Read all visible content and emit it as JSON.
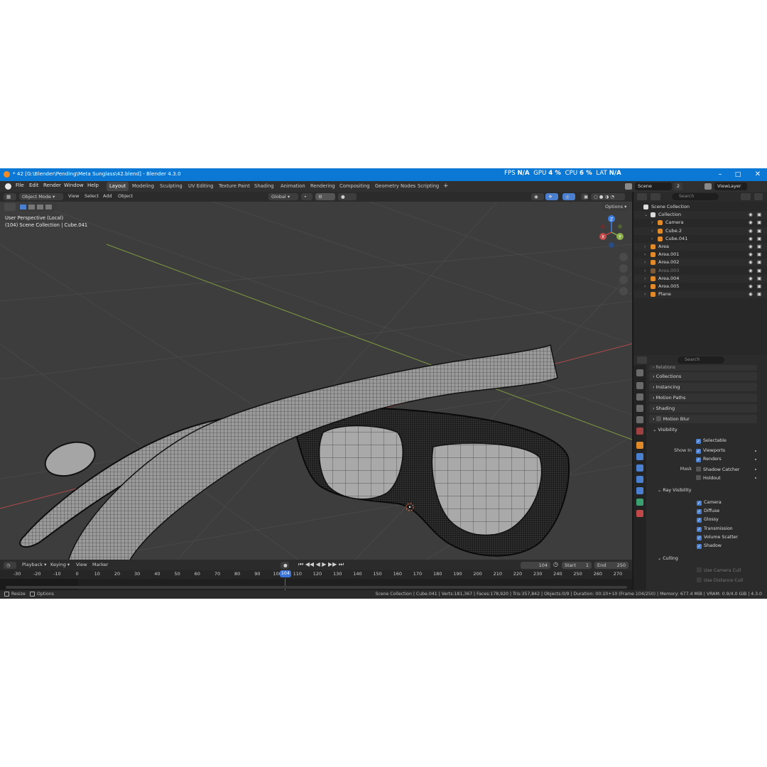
{
  "window": {
    "title": "* 42 [G:\\Blender\\Pending\\Meta Sunglass\\42.blend] - Blender 4.3.0",
    "fps_label": "FPS",
    "fps_value": "N/A",
    "gpu_label": "GPU",
    "gpu_value": "4 %",
    "cpu_label": "CPU",
    "cpu_value": "6 %",
    "lat_label": "LAT",
    "lat_value": "N/A"
  },
  "menubar": {
    "items": [
      "File",
      "Edit",
      "Render",
      "Window",
      "Help"
    ],
    "workspaces": [
      "Layout",
      "Modeling",
      "Sculpting",
      "UV Editing",
      "Texture Paint",
      "Shading",
      "Animation",
      "Rendering",
      "Compositing",
      "Geometry Nodes",
      "Scripting"
    ],
    "add_tab": "+",
    "scene": "Scene",
    "scene_count": "2",
    "view_layer": "ViewLayer"
  },
  "viewport_header": {
    "mode": "Object Mode",
    "view": "View",
    "select": "Select",
    "add": "Add",
    "object": "Object",
    "orientation": "Global",
    "options": "Options"
  },
  "viewport": {
    "perspective": "User Perspective (Local)",
    "collection_info": "(104) Scene Collection | Cube.041",
    "gizmo_x": "X",
    "gizmo_y": "Y",
    "gizmo_z": "Z"
  },
  "outliner": {
    "search_placeholder": "Search",
    "rows": [
      {
        "name": "Scene Collection",
        "indent": 0,
        "type": "scene"
      },
      {
        "name": "Collection",
        "indent": 1,
        "type": "collection"
      },
      {
        "name": "Camera",
        "indent": 2,
        "type": "camera"
      },
      {
        "name": "Cube.2",
        "indent": 2,
        "type": "mesh"
      },
      {
        "name": "Cube.041",
        "indent": 2,
        "type": "mesh"
      },
      {
        "name": "Area",
        "indent": 1,
        "type": "light"
      },
      {
        "name": "Area.001",
        "indent": 1,
        "type": "light"
      },
      {
        "name": "Area.002",
        "indent": 1,
        "type": "light"
      },
      {
        "name": "Area.003",
        "indent": 1,
        "type": "light-dim"
      },
      {
        "name": "Area.004",
        "indent": 1,
        "type": "light"
      },
      {
        "name": "Area.005",
        "indent": 1,
        "type": "light"
      },
      {
        "name": "Plane",
        "indent": 1,
        "type": "mesh"
      }
    ]
  },
  "properties": {
    "search_placeholder": "Search",
    "sections": {
      "relations": "Relations",
      "collections": "Collections",
      "instancing": "Instancing",
      "motion_paths": "Motion Paths",
      "shading": "Shading",
      "motion_blur": "Motion Blur",
      "visibility": "Visibility",
      "ray_visibility": "Ray Visibility",
      "culling": "Culling"
    },
    "visibility": {
      "selectable": "Selectable",
      "show_in_label": "Show In",
      "viewports": "Viewports",
      "renders": "Renders",
      "mask_label": "Mask",
      "shadow_catcher": "Shadow Catcher",
      "holdout": "Holdout"
    },
    "ray_visibility": [
      "Camera",
      "Diffuse",
      "Glossy",
      "Transmission",
      "Volume Scatter",
      "Shadow"
    ],
    "culling": {
      "use_camera_cull": "Use Camera Cull",
      "use_distance_cull": "Use Distance Cull"
    }
  },
  "timeline": {
    "playback": "Playback",
    "keying": "Keying",
    "view": "View",
    "marker": "Marker",
    "current_frame": "104",
    "start_label": "Start",
    "start_value": "1",
    "end_label": "End",
    "end_value": "250",
    "ticks": [
      "-30",
      "-20",
      "-10",
      "0",
      "10",
      "20",
      "30",
      "40",
      "50",
      "60",
      "70",
      "80",
      "90",
      "100",
      "110",
      "120",
      "130",
      "140",
      "150",
      "160",
      "170",
      "180",
      "190",
      "200",
      "210",
      "220",
      "230",
      "240",
      "250",
      "260",
      "270"
    ],
    "playhead_label": "104"
  },
  "statusbar": {
    "resize": "Resize",
    "options": "Options",
    "info": "Scene Collection | Cube.041 | Verts:181,367 | Faces:178,920 | Tris:357,842 | Objects:0/9 | Duration: 00:10+10 (Frame 104/250) | Memory: 677.4 MiB | VRAM: 0.9/4.0 GiB | 4.3.0"
  },
  "colors": {
    "titlebar": "#0a78d4",
    "accent": "#4a7fd0",
    "viewport_bg": "#3d3d3d",
    "axis_x": "#c44a4a",
    "axis_y": "#8bb04a",
    "gizmo_z": "#3b7de0"
  }
}
